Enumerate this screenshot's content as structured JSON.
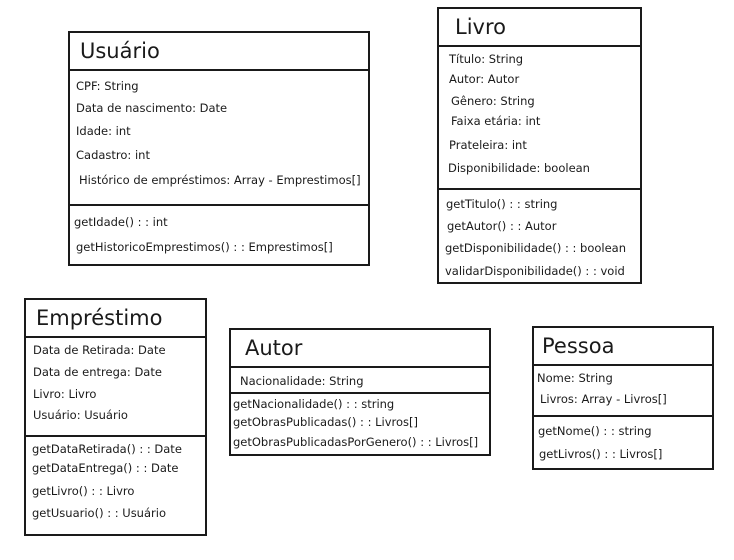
{
  "diagram": {
    "classes": {
      "usuario": {
        "name": "Usuário",
        "attributes": [
          "CPF: String",
          "Data de nascimento: Date",
          "Idade: int",
          "Cadastro: int",
          "Histórico de empréstimos: Array - Emprestimos[]"
        ],
        "methods": [
          "getIdade() : : int",
          "getHistoricoEmprestimos() : : Emprestimos[]"
        ]
      },
      "livro": {
        "name": "Livro",
        "attributes": [
          "Título: String",
          "Autor: Autor",
          "Gênero: String",
          "Faixa etária: int",
          "Prateleira: int",
          "Disponibilidade: boolean"
        ],
        "methods": [
          "getTitulo() : : string",
          "getAutor() : : Autor",
          "getDisponibilidade() : : boolean",
          "validarDisponibilidade() : : void"
        ]
      },
      "emprestimo": {
        "name": "Empréstimo",
        "attributes": [
          "Data de Retirada: Date",
          "Data de entrega: Date",
          "Livro: Livro",
          "Usuário: Usuário"
        ],
        "methods": [
          "getDataRetirada() : : Date",
          "getDataEntrega() : : Date",
          "getLivro() : : Livro",
          "getUsuario() : : Usuário"
        ]
      },
      "autor": {
        "name": "Autor",
        "attributes": [
          "Nacionalidade: String"
        ],
        "methods": [
          "getNacionalidade() : : string",
          "getObrasPublicadas() : : Livros[]",
          "getObrasPublicadasPorGenero() : : Livros[]"
        ]
      },
      "pessoa": {
        "name": "Pessoa",
        "attributes": [
          "Nome: String",
          "Livros: Array - Livros[]"
        ],
        "methods": [
          "getNome() : : string",
          "getLivros() : : Livros[]"
        ]
      }
    }
  }
}
